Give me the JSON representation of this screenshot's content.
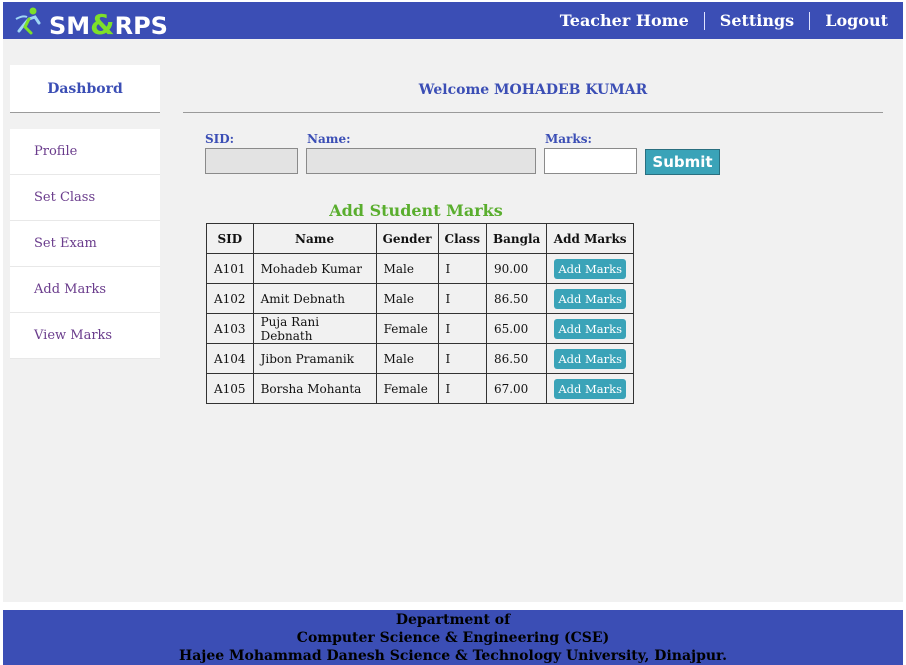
{
  "header": {
    "logo_prefix": "SM",
    "logo_amp": "&",
    "logo_suffix": "RPS",
    "nav": [
      "Teacher Home",
      "Settings",
      "Logout"
    ]
  },
  "sidebar": {
    "title": "Dashbord",
    "items": [
      "Profile",
      "Set Class",
      "Set Exam",
      "Add Marks",
      "View Marks"
    ]
  },
  "welcome": "Welcome MOHADEB KUMAR",
  "form": {
    "sid_label": "SID:",
    "name_label": "Name:",
    "marks_label": "Marks:",
    "sid_value": "",
    "name_value": "",
    "marks_value": "",
    "submit_label": "Submit"
  },
  "table": {
    "title": "Add Student Marks",
    "columns": [
      "SID",
      "Name",
      "Gender",
      "Class",
      "Bangla",
      "Add Marks"
    ],
    "action_label": "Add Marks",
    "rows": [
      {
        "sid": "A101",
        "name": "Mohadeb Kumar",
        "gender": "Male",
        "class": "I",
        "bangla": "90.00"
      },
      {
        "sid": "A102",
        "name": "Amit Debnath",
        "gender": "Male",
        "class": "I",
        "bangla": "86.50"
      },
      {
        "sid": "A103",
        "name": "Puja Rani Debnath",
        "gender": "Female",
        "class": "I",
        "bangla": "65.00"
      },
      {
        "sid": "A104",
        "name": "Jibon Pramanik",
        "gender": "Male",
        "class": "I",
        "bangla": "86.50"
      },
      {
        "sid": "A105",
        "name": "Borsha Mohanta",
        "gender": "Female",
        "class": "I",
        "bangla": "67.00"
      }
    ]
  },
  "footer": {
    "line1": "Department of",
    "line2": "Computer Science & Engineering (CSE)",
    "line3": "Hajee Mohammad Danesh Science & Technology University, Dinajpur."
  },
  "colors": {
    "brand_blue": "#3b4eb5",
    "button_teal": "#3aa3b8",
    "title_green": "#5aae2e",
    "logo_green": "#7de02a"
  }
}
